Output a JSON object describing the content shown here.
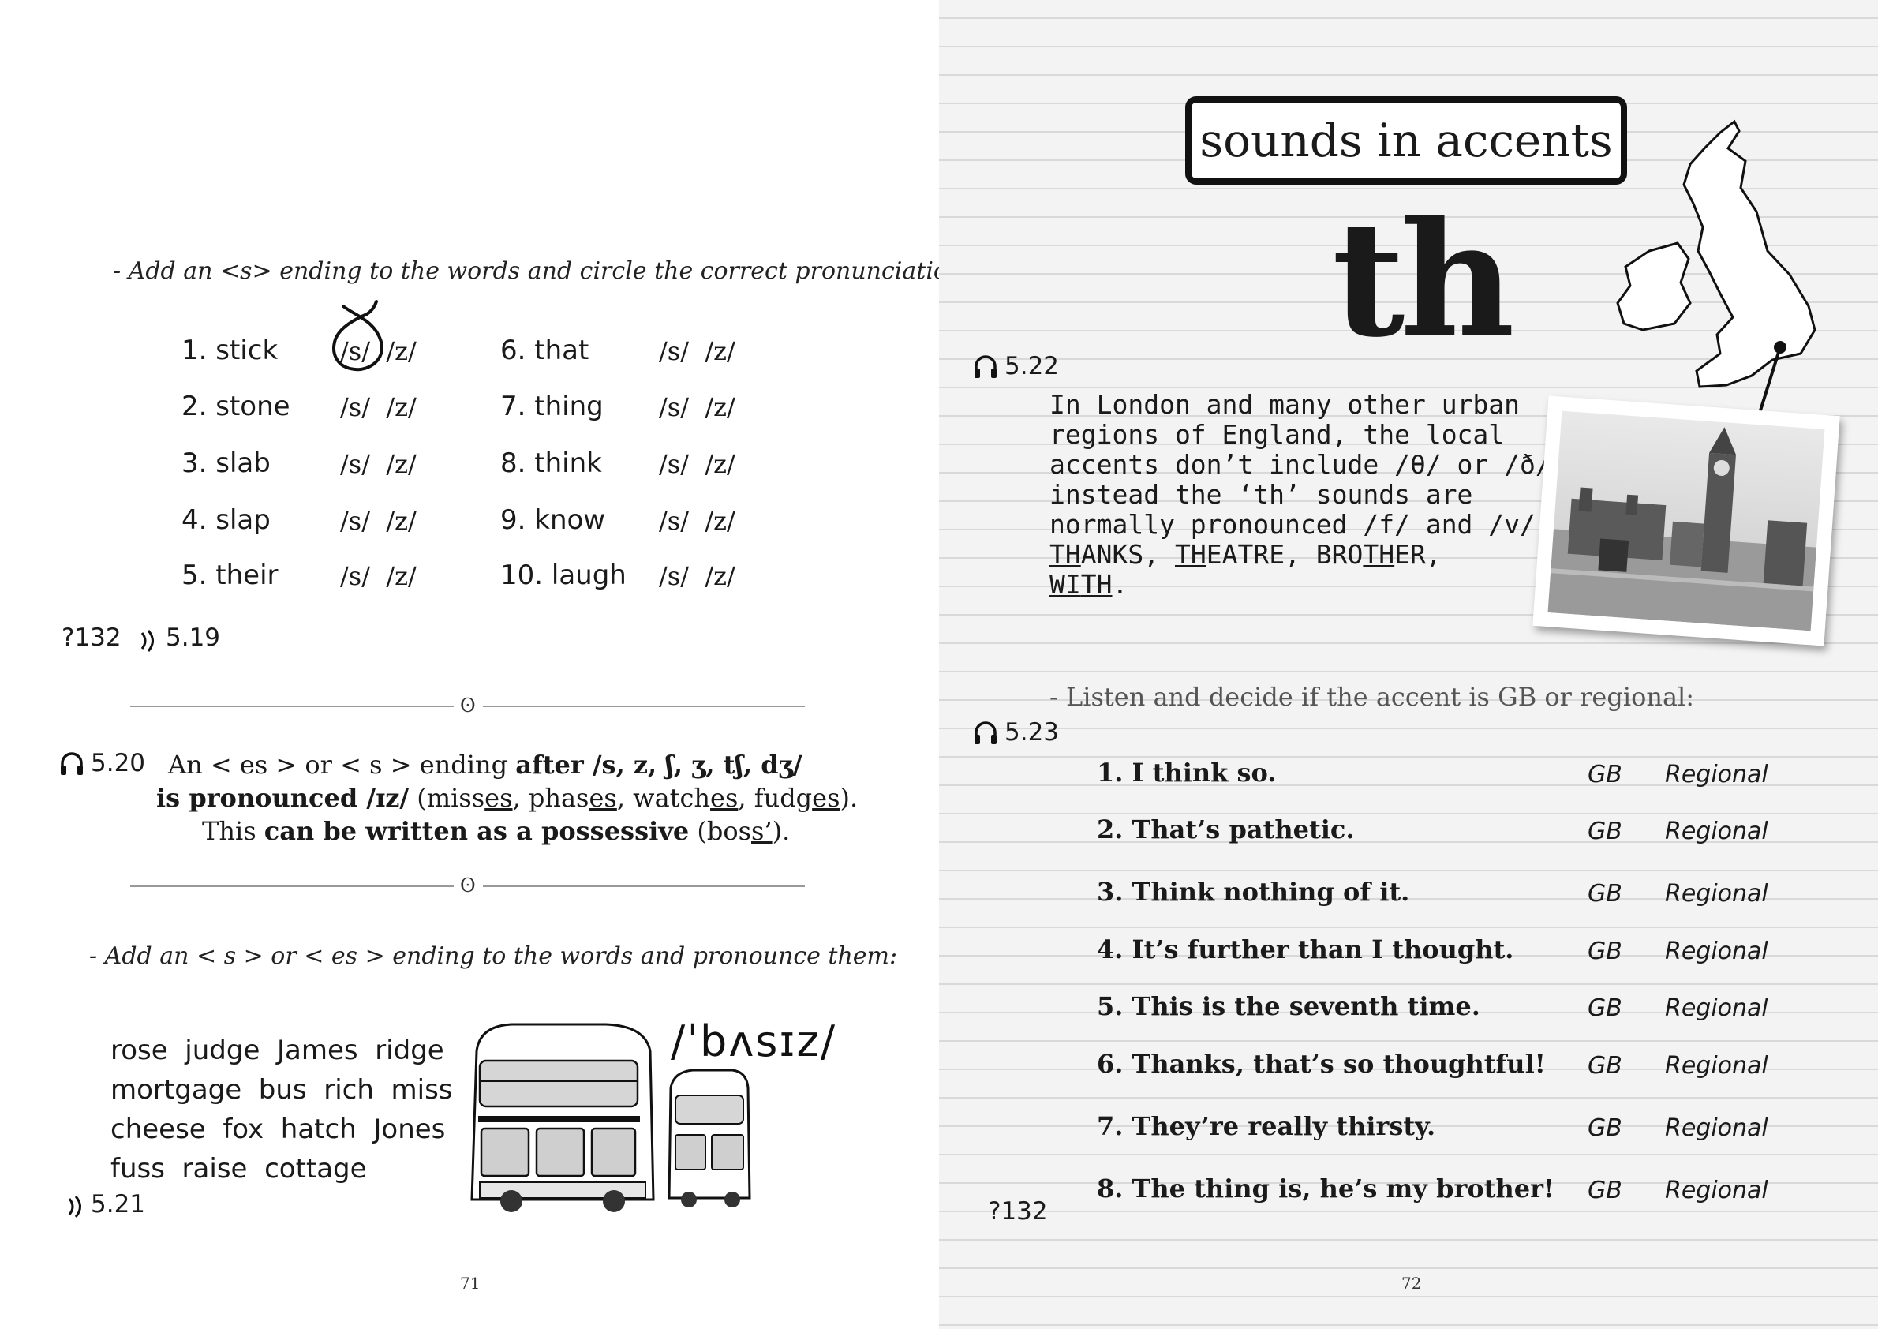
{
  "left": {
    "instruction1": "- Add an <s> ending to the words and circle the correct pronunciation:",
    "items": [
      {
        "num": "1.",
        "word": "stick",
        "s": "/s/",
        "z": "/z/"
      },
      {
        "num": "2.",
        "word": "stone",
        "s": "/s/",
        "z": "/z/"
      },
      {
        "num": "3.",
        "word": "slab",
        "s": "/s/",
        "z": "/z/"
      },
      {
        "num": "4.",
        "word": "slap",
        "s": "/s/",
        "z": "/z/"
      },
      {
        "num": "5.",
        "word": "their",
        "s": "/s/",
        "z": "/z/"
      },
      {
        "num": "6.",
        "word": "that",
        "s": "/s/",
        "z": "/z/"
      },
      {
        "num": "7.",
        "word": "thing",
        "s": "/s/",
        "z": "/z/"
      },
      {
        "num": "8.",
        "word": "think",
        "s": "/s/",
        "z": "/z/"
      },
      {
        "num": "9.",
        "word": "know",
        "s": "/s/",
        "z": "/z/"
      },
      {
        "num": "10.",
        "word": "laugh",
        "s": "/s/",
        "z": "/z/"
      }
    ],
    "ref1_q": "?132",
    "ref1_audio": "5.19",
    "rule_audio": "5.20",
    "rule_line1_pre": "An < es > or < s > ending ",
    "rule_line1_bold": "after /s, z, ʃ, ʒ, tʃ, dʒ/",
    "rule_line2_bold": "is pronounced /ɪz/",
    "rule_line2_a": " (miss",
    "rule_line2_b": "es",
    "rule_line2_c": ", phas",
    "rule_line2_d": "es",
    "rule_line2_e": ", watch",
    "rule_line2_f": "es",
    "rule_line2_g": ", fudg",
    "rule_line2_h": "es",
    "rule_line2_i": ").",
    "rule_line3_pre": "This ",
    "rule_line3_bold": "can be written as a possessive",
    "rule_line3_a": " (bos",
    "rule_line3_b": "s’",
    "rule_line3_c": ").",
    "instruction2": "- Add an < s > or < es > ending to the words and pronounce them:",
    "words_lines": [
      "rose  judge  James  ridge",
      "mortgage  bus  rich  miss",
      "cheese  fox  hatch  Jones",
      "fuss  raise  cottage"
    ],
    "ref2_audio": "5.21",
    "ipa_buses": "/ˈbʌsɪz/",
    "page_number": "71"
  },
  "right": {
    "title": "sounds in accents",
    "big": "th",
    "audio1": "5.22",
    "para_lines": [
      "In London and many other urban",
      "regions of England, the local",
      "accents don’t include /θ/ or /ð/,",
      "instead the ‘th’ sounds are",
      "normally pronounced /f/ and /v/:"
    ],
    "ex1a": "TH",
    "ex1b": "ANKS, ",
    "ex2a": "TH",
    "ex2b": "EATRE, ",
    "ex3a": "BRO",
    "ex3b": "TH",
    "ex3c": "ER,",
    "ex4a": "WI",
    "ex4b": "TH",
    "ex4c": ".",
    "instruction": "- Listen and decide if the accent is GB or regional:",
    "audio2": "5.23",
    "questions": [
      {
        "num": "1.",
        "text": "I think so."
      },
      {
        "num": "2.",
        "text": "That’s pathetic."
      },
      {
        "num": "3.",
        "text": "Think nothing of it."
      },
      {
        "num": "4.",
        "text": "It’s further than I thought."
      },
      {
        "num": "5.",
        "text": "This is the seventh time."
      },
      {
        "num": "6.",
        "text": "Thanks, that’s so thoughtful!"
      },
      {
        "num": "7.",
        "text": "They’re really thirsty."
      },
      {
        "num": "8.",
        "text": "The thing is, he’s my brother!"
      }
    ],
    "opt_gb": "GB",
    "opt_regional": "Regional",
    "ref_q": "?132",
    "page_number": "72"
  }
}
